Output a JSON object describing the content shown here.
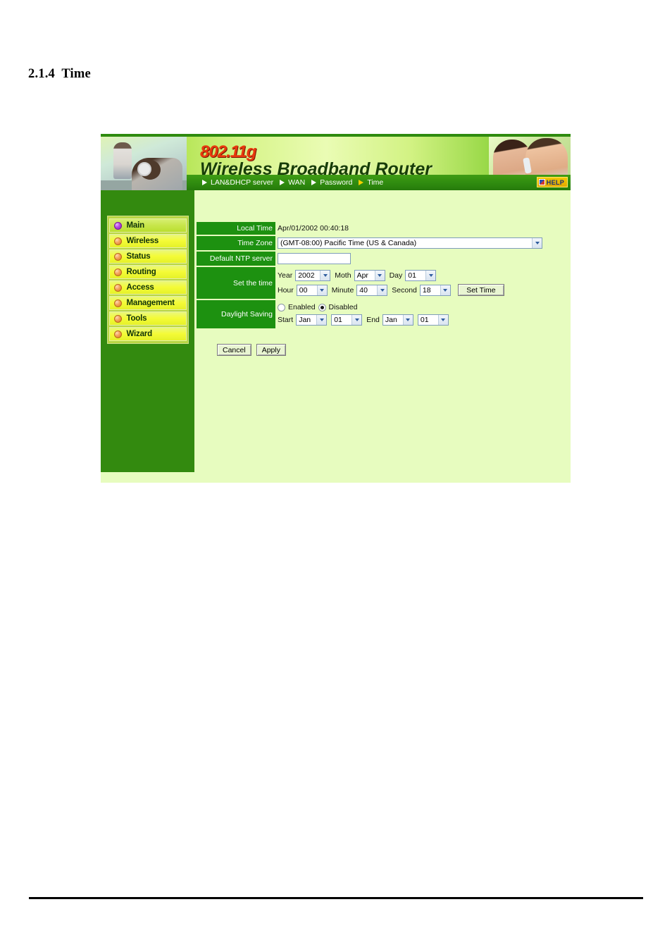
{
  "document": {
    "heading": "2.1.4  Time"
  },
  "banner": {
    "logo_standard": "802.11g",
    "logo_title": "Wireless  Broadband  Router",
    "help_label": "HELP",
    "help_icon": "help-icon"
  },
  "nav": {
    "items": [
      {
        "label": "LAN&DHCP server",
        "active": false
      },
      {
        "label": "WAN",
        "active": false
      },
      {
        "label": "Password",
        "active": false
      },
      {
        "label": "Time",
        "active": true
      }
    ]
  },
  "sidebar": {
    "items": [
      {
        "label": "Main",
        "bullet": "purple"
      },
      {
        "label": "Wireless",
        "bullet": "orange"
      },
      {
        "label": "Status",
        "bullet": "orange"
      },
      {
        "label": "Routing",
        "bullet": "orange"
      },
      {
        "label": "Access",
        "bullet": "orange"
      },
      {
        "label": "Management",
        "bullet": "orange"
      },
      {
        "label": "Tools",
        "bullet": "orange"
      },
      {
        "label": "Wizard",
        "bullet": "orange"
      }
    ]
  },
  "form": {
    "local_time": {
      "label": "Local Time",
      "value": "Apr/01/2002 00:40:18"
    },
    "time_zone": {
      "label": "Time Zone",
      "value": "(GMT-08:00) Pacific Time (US & Canada)"
    },
    "ntp_server": {
      "label": "Default NTP server",
      "value": "",
      "placeholder": ""
    },
    "set_time": {
      "label": "Set the time",
      "year_label": "Year",
      "year_value": "2002",
      "month_label": "Moth",
      "month_value": "Apr",
      "day_label": "Day",
      "day_value": "01",
      "hour_label": "Hour",
      "hour_value": "00",
      "minute_label": "Minute",
      "minute_value": "40",
      "second_label": "Second",
      "second_value": "18",
      "button_label": "Set Time"
    },
    "daylight_saving": {
      "label": "Daylight Saving",
      "enabled_label": "Enabled",
      "disabled_label": "Disabled",
      "selected": "Disabled",
      "start_label": "Start",
      "start_month": "Jan",
      "start_day": "01",
      "end_label": "End",
      "end_month": "Jan",
      "end_day": "01"
    }
  },
  "actions": {
    "cancel_label": "Cancel",
    "apply_label": "Apply"
  },
  "colors": {
    "sidebar_green": "#338a0f",
    "label_green": "#1d9110",
    "content_bg": "#e7fcbf",
    "nav_green": "#2f8b0f",
    "logo_red": "#e8380d",
    "menu_yellow": "#f4fb37"
  }
}
